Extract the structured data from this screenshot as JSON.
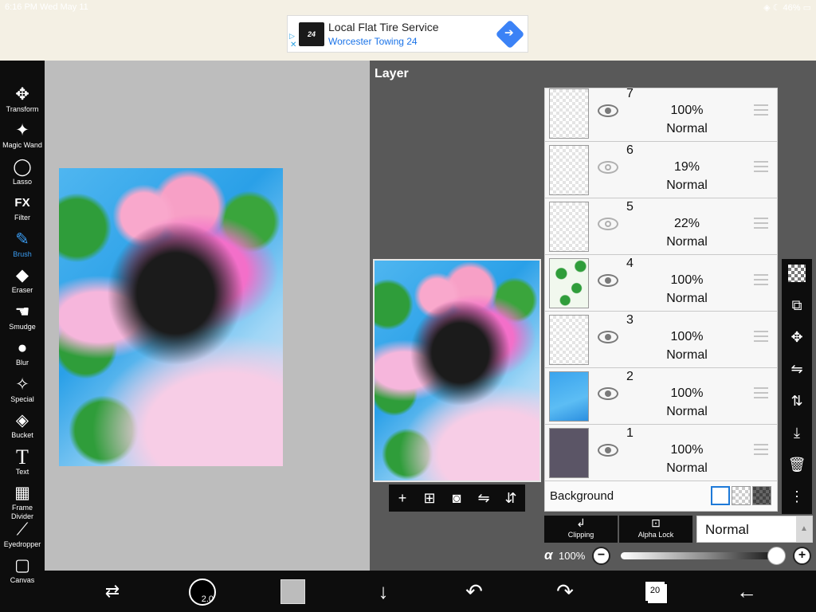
{
  "status": {
    "time": "6:16 PM   Wed May 11",
    "right": "◈ ☾ 46% ▭"
  },
  "ad": {
    "title": "Local Flat Tire Service",
    "subtitle": "Worcester Towing 24",
    "logo_text": "24"
  },
  "toolbar": {
    "items": [
      {
        "label": "Transform",
        "glyph": "✥"
      },
      {
        "label": "Magic Wand",
        "glyph": "✦"
      },
      {
        "label": "Lasso",
        "glyph": "◯"
      },
      {
        "label": "Filter",
        "glyph": "FX"
      },
      {
        "label": "Brush",
        "glyph": "✎"
      },
      {
        "label": "Eraser",
        "glyph": "◆"
      },
      {
        "label": "Smudge",
        "glyph": "☚"
      },
      {
        "label": "Blur",
        "glyph": "●"
      },
      {
        "label": "Special",
        "glyph": "✧"
      },
      {
        "label": "Bucket",
        "glyph": "◈"
      },
      {
        "label": "Text",
        "glyph": "T"
      },
      {
        "label": "Frame Divider",
        "glyph": "▦"
      },
      {
        "label": "Eyedropper",
        "glyph": "⟋"
      },
      {
        "label": "Canvas",
        "glyph": "▢"
      }
    ],
    "active": "Brush"
  },
  "layer_panel": {
    "title": "Layer",
    "layers": [
      {
        "number": "7",
        "opacity": "100%",
        "mode": "Normal",
        "visible": true
      },
      {
        "number": "6",
        "opacity": "19%",
        "mode": "Normal",
        "visible": false
      },
      {
        "number": "5",
        "opacity": "22%",
        "mode": "Normal",
        "visible": false
      },
      {
        "number": "4",
        "opacity": "100%",
        "mode": "Normal",
        "visible": true
      },
      {
        "number": "3",
        "opacity": "100%",
        "mode": "Normal",
        "visible": true
      },
      {
        "number": "2",
        "opacity": "100%",
        "mode": "Normal",
        "visible": true
      },
      {
        "number": "1",
        "opacity": "100%",
        "mode": "Normal",
        "visible": true
      }
    ],
    "background_label": "Background",
    "preview_tools": [
      "+",
      "⊞",
      "◙",
      "⇋",
      "⇵"
    ],
    "side_tools": [
      "checker",
      "⧉",
      "✥",
      "⇋",
      "⇅",
      "⤓",
      "🗑",
      "⋮"
    ],
    "clipping_label": "Clipping",
    "clipping_glyph": "↲",
    "alpha_lock_label": "Alpha Lock",
    "alpha_lock_glyph": "⊡",
    "blend_mode": "Normal",
    "blend_arrow": "▲",
    "alpha_symbol": "α",
    "alpha_value": "100%",
    "alpha_fraction": 1.0,
    "minus": "−",
    "plus": "+"
  },
  "bottom_bar": {
    "brush_size": "2.0",
    "layers_count": "20",
    "glyphs": {
      "swap": "⇄",
      "down": "↓",
      "undo": "↶",
      "redo": "↷",
      "back": "←"
    }
  }
}
